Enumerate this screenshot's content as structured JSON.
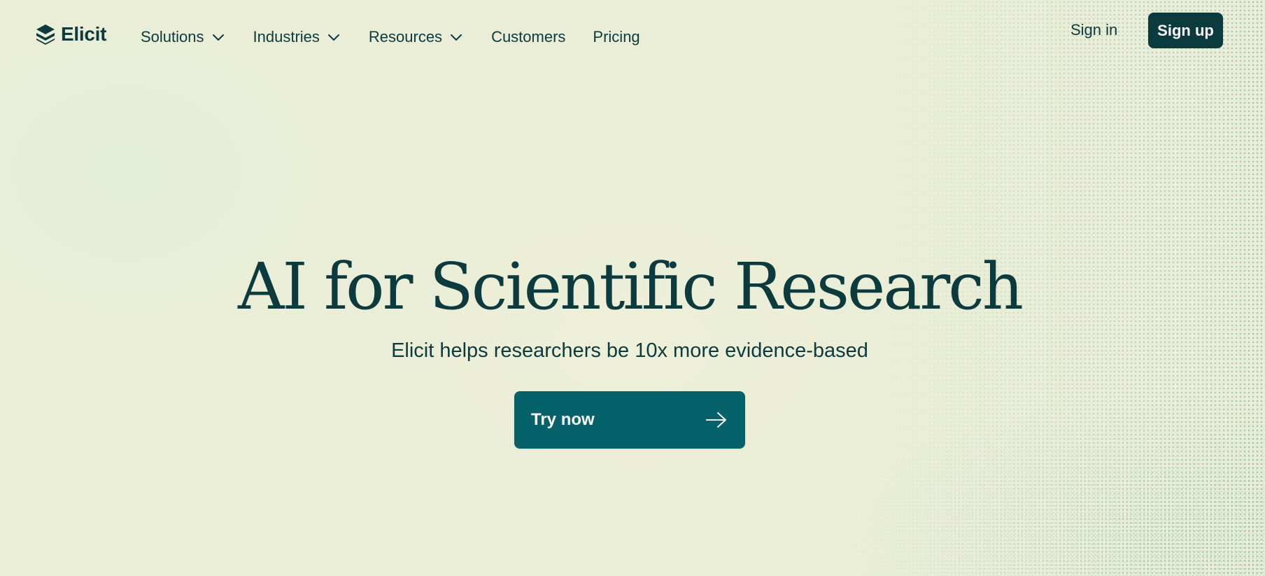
{
  "brand": {
    "name": "Elicit",
    "logo_icon": "stacked-layers-logo-icon"
  },
  "nav": {
    "items": [
      {
        "label": "Solutions",
        "has_dropdown": true
      },
      {
        "label": "Industries",
        "has_dropdown": true
      },
      {
        "label": "Resources",
        "has_dropdown": true
      },
      {
        "label": "Customers",
        "has_dropdown": false
      },
      {
        "label": "Pricing",
        "has_dropdown": false
      }
    ],
    "dropdown_icon": "chevron-down-icon",
    "sign_in_label": "Sign in",
    "sign_up_label": "Sign up"
  },
  "hero": {
    "title": "AI for Scientific Research",
    "subtitle": "Elicit helps researchers be 10x more evidence-based",
    "cta_label": "Try now",
    "cta_icon": "arrow-right-icon"
  },
  "colors": {
    "background": "#eaeed6",
    "text_primary": "#0b3b3f",
    "sign_up_bg": "#0b3b3f",
    "cta_bg": "#05616a",
    "cta_text": "#ffffff",
    "dot_pattern": "#58a08c"
  }
}
